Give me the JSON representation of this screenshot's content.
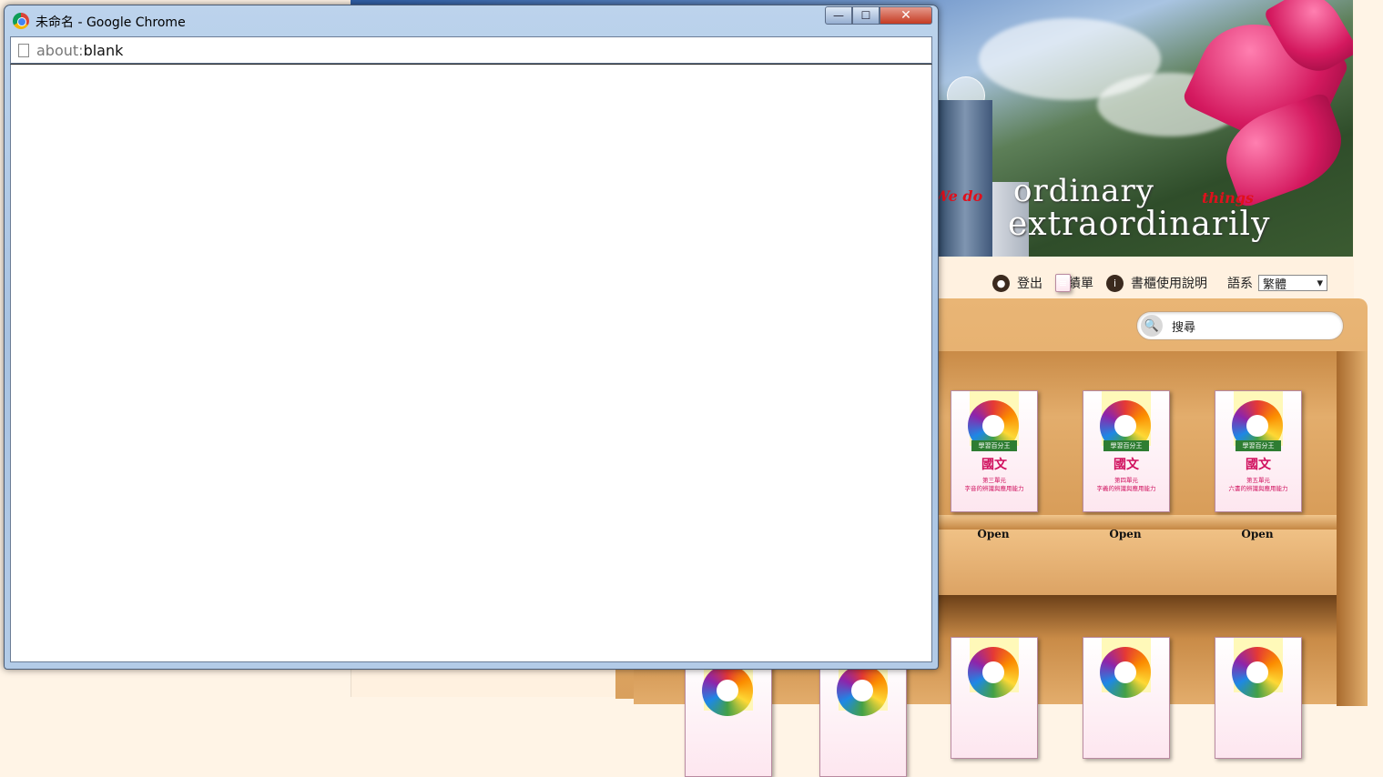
{
  "window": {
    "title": "未命名 - Google Chrome",
    "address_scheme": "about:",
    "address_rest": "blank",
    "controls": {
      "minimize": "—",
      "maximize": "☐",
      "close": "✕"
    }
  },
  "banner": {
    "slogan_red_1": "We do",
    "slogan_line_1": "ordinary",
    "slogan_red_2": "things",
    "slogan_line_2": "extraordinarily"
  },
  "toolbar": {
    "logout_label": "登出",
    "grades_label": "成績單",
    "help_label": "書櫃使用說明",
    "language_label": "語系",
    "language_selected": "繁體"
  },
  "search": {
    "placeholder": "搜尋",
    "value": "搜尋"
  },
  "books": [
    {
      "badge": "學習百分王",
      "title": "國文",
      "subtitle_1": "第三單元",
      "subtitle_2": "字音的辨識與應用能力",
      "open_label": "Open"
    },
    {
      "badge": "學習百分王",
      "title": "國文",
      "subtitle_1": "第四單元",
      "subtitle_2": "字義的辨識與應用能力",
      "open_label": "Open"
    },
    {
      "badge": "學習百分王",
      "title": "國文",
      "subtitle_1": "第五單元",
      "subtitle_2": "六書的辨識與應用能力",
      "open_label": "Open"
    }
  ],
  "colors": {
    "accent_title": "#d0105e",
    "shelf_wood": "#e3ad6c",
    "window_frame": "#a7c2e2"
  }
}
